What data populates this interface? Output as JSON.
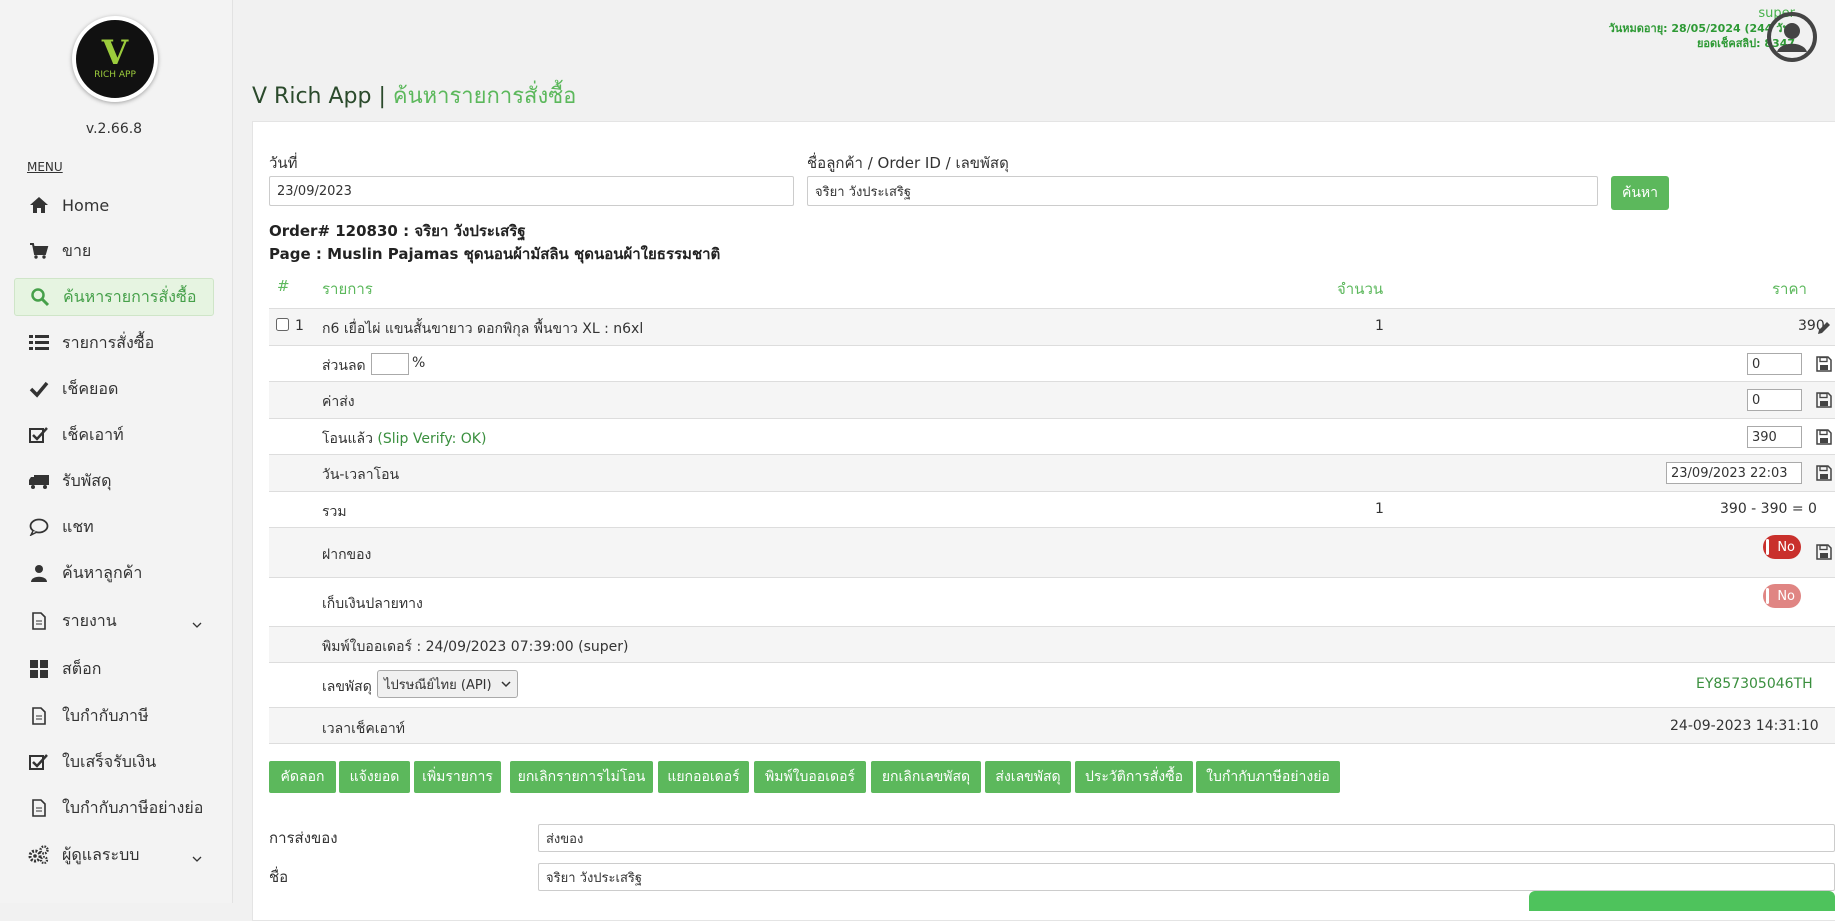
{
  "sidebar": {
    "logo_letter": "V",
    "logo_text": "RICH APP",
    "version": "v.2.66.8",
    "menu_label": "MENU",
    "items": [
      {
        "label": "Home",
        "icon": "home-icon"
      },
      {
        "label": "ขาย",
        "icon": "cart-icon"
      },
      {
        "label": "ค้นหารายการสั่งซื้อ",
        "icon": "search-icon"
      },
      {
        "label": "รายการสั่งซื้อ",
        "icon": "list-icon"
      },
      {
        "label": "เช็คยอด",
        "icon": "check-icon"
      },
      {
        "label": "เช็คเอาท์",
        "icon": "check-square-icon"
      },
      {
        "label": "รับพัสดุ",
        "icon": "truck-icon"
      },
      {
        "label": "แชท",
        "icon": "chat-icon"
      },
      {
        "label": "ค้นหาลูกค้า",
        "icon": "user-icon"
      },
      {
        "label": "รายงาน",
        "icon": "file-icon"
      },
      {
        "label": "สต็อก",
        "icon": "grid-icon"
      },
      {
        "label": "ใบกำกับภาษี",
        "icon": "file-icon"
      },
      {
        "label": "ใบเสร็จรับเงิน",
        "icon": "check-square-icon"
      },
      {
        "label": "ใบกำกับภาษีอย่างย่อ",
        "icon": "file-icon"
      },
      {
        "label": "ผู้ดูแลระบบ",
        "icon": "gears-icon"
      }
    ]
  },
  "topbar": {
    "username": "super",
    "expiry": "วันหมดอายุ: 28/05/2024 (244 วัน)",
    "slip_balance": "ยอดเช็คสลิป: 8347"
  },
  "header": {
    "app_name": "V Rich App | ",
    "page_name": "ค้นหารายการสั่งซื้อ"
  },
  "search": {
    "date_label": "วันที่",
    "date_value": "23/09/2023",
    "query_label": "ชื่อลูกค้า / Order ID / เลขพัสดุ",
    "query_value": "จริยา วังประเสริฐ",
    "button_label": "ค้นหา"
  },
  "order": {
    "title": "Order# 120830 : จริยา วังประเสริฐ",
    "page": "Page : Muslin Pajamas ชุดนอนผ้ามัสลิน ชุดนอนผ้าใยธรรมชาติ",
    "col_num": "#",
    "col_item": "รายการ",
    "col_qty": "จำนวน",
    "col_price": "ราคา",
    "item_no": "1",
    "item_name": "ก6 เยื่อไผ่ แขนสั้นขายาว ดอกพิกุล พื้นขาว XL : n6xl",
    "item_qty": "1",
    "item_price": "390",
    "discount_label": "ส่วนลด",
    "discount_pct_value": "",
    "pct_sign": "%",
    "discount_value": "0",
    "shipping_label": "ค่าส่ง",
    "shipping_value": "0",
    "paid_label": "โอนแล้ว",
    "paid_status": "(Slip Verify: OK)",
    "paid_value": "390",
    "paid_time_label": "วัน-เวลาโอน",
    "paid_time_value": "23/09/2023 22:03",
    "total_label": "รวม",
    "total_qty": "1",
    "total_value": "390 - 390 = 0",
    "deposit_label": "ฝากของ",
    "deposit_toggle": "No",
    "cod_label": "เก็บเงินปลายทาง",
    "cod_toggle": "No",
    "printed": "พิมพ์ใบออเดอร์ : 24/09/2023 07:39:00 (super)",
    "tracking_label": "เลขพัสดุ",
    "courier": "ไปรษณีย์ไทย (API)",
    "tracking_no": "EY857305046TH",
    "checkout_label": "เวลาเช็คเอาท์",
    "checkout_time": "24-09-2023 14:31:10"
  },
  "actions": [
    "คัดลอก",
    "แจ้งยอด",
    "เพิ่มรายการ",
    "ยกเลิกรายการไม่โอน",
    "แยกออเดอร์",
    "พิมพ์ใบออเดอร์",
    "ยกเลิกเลขพัสดุ",
    "ส่งเลขพัสดุ",
    "ประวัติการสั่งซื้อ",
    "ใบกำกับภาษีอย่างย่อ"
  ],
  "shipping_form": {
    "delivery_label": "การส่งของ",
    "delivery_value": "ส่งของ",
    "name_label": "ชื่อ",
    "name_value": "จริยา วังประเสริฐ"
  },
  "colors": {
    "accent": "#5cb85c",
    "toggle_no": "#c9302c",
    "toggle_no_disabled": "#e08583",
    "title_dark": "#2b4a2c"
  }
}
